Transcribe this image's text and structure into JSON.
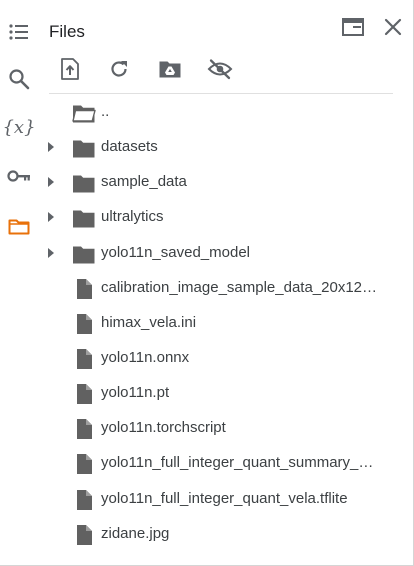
{
  "panel": {
    "title": "Files"
  },
  "rail": {
    "items": [
      {
        "icon": "table-of-contents-icon"
      },
      {
        "icon": "search-icon"
      },
      {
        "icon": "variables-icon",
        "label": "{x}"
      },
      {
        "icon": "secrets-key-icon"
      },
      {
        "icon": "folder-icon",
        "active": true
      }
    ]
  },
  "toolbar": {
    "items": [
      {
        "icon": "upload-icon"
      },
      {
        "icon": "refresh-icon"
      },
      {
        "icon": "mount-drive-icon"
      },
      {
        "icon": "hide-hidden-files-icon"
      }
    ]
  },
  "header_actions": [
    {
      "icon": "open-in-window-icon"
    },
    {
      "icon": "close-icon"
    }
  ],
  "tree": {
    "rows": [
      {
        "name": "..",
        "type": "parent",
        "expandable": false
      },
      {
        "name": "datasets",
        "type": "folder",
        "expandable": true
      },
      {
        "name": "sample_data",
        "type": "folder",
        "expandable": true
      },
      {
        "name": "ultralytics",
        "type": "folder",
        "expandable": true
      },
      {
        "name": "yolo11n_saved_model",
        "type": "folder",
        "expandable": true
      },
      {
        "name": "calibration_image_sample_data_20x12…",
        "type": "file",
        "expandable": false
      },
      {
        "name": "himax_vela.ini",
        "type": "file",
        "expandable": false
      },
      {
        "name": "yolo11n.onnx",
        "type": "file",
        "expandable": false
      },
      {
        "name": "yolo11n.pt",
        "type": "file",
        "expandable": false
      },
      {
        "name": "yolo11n.torchscript",
        "type": "file",
        "expandable": false
      },
      {
        "name": "yolo11n_full_integer_quant_summary_…",
        "type": "file",
        "expandable": false
      },
      {
        "name": "yolo11n_full_integer_quant_vela.tflite",
        "type": "file",
        "expandable": false
      },
      {
        "name": "zidane.jpg",
        "type": "file",
        "expandable": false
      }
    ]
  },
  "colors": {
    "icon": "#5f6368",
    "icon_dark": "#616161",
    "text": "#3c4043",
    "active": "#e8710a"
  }
}
